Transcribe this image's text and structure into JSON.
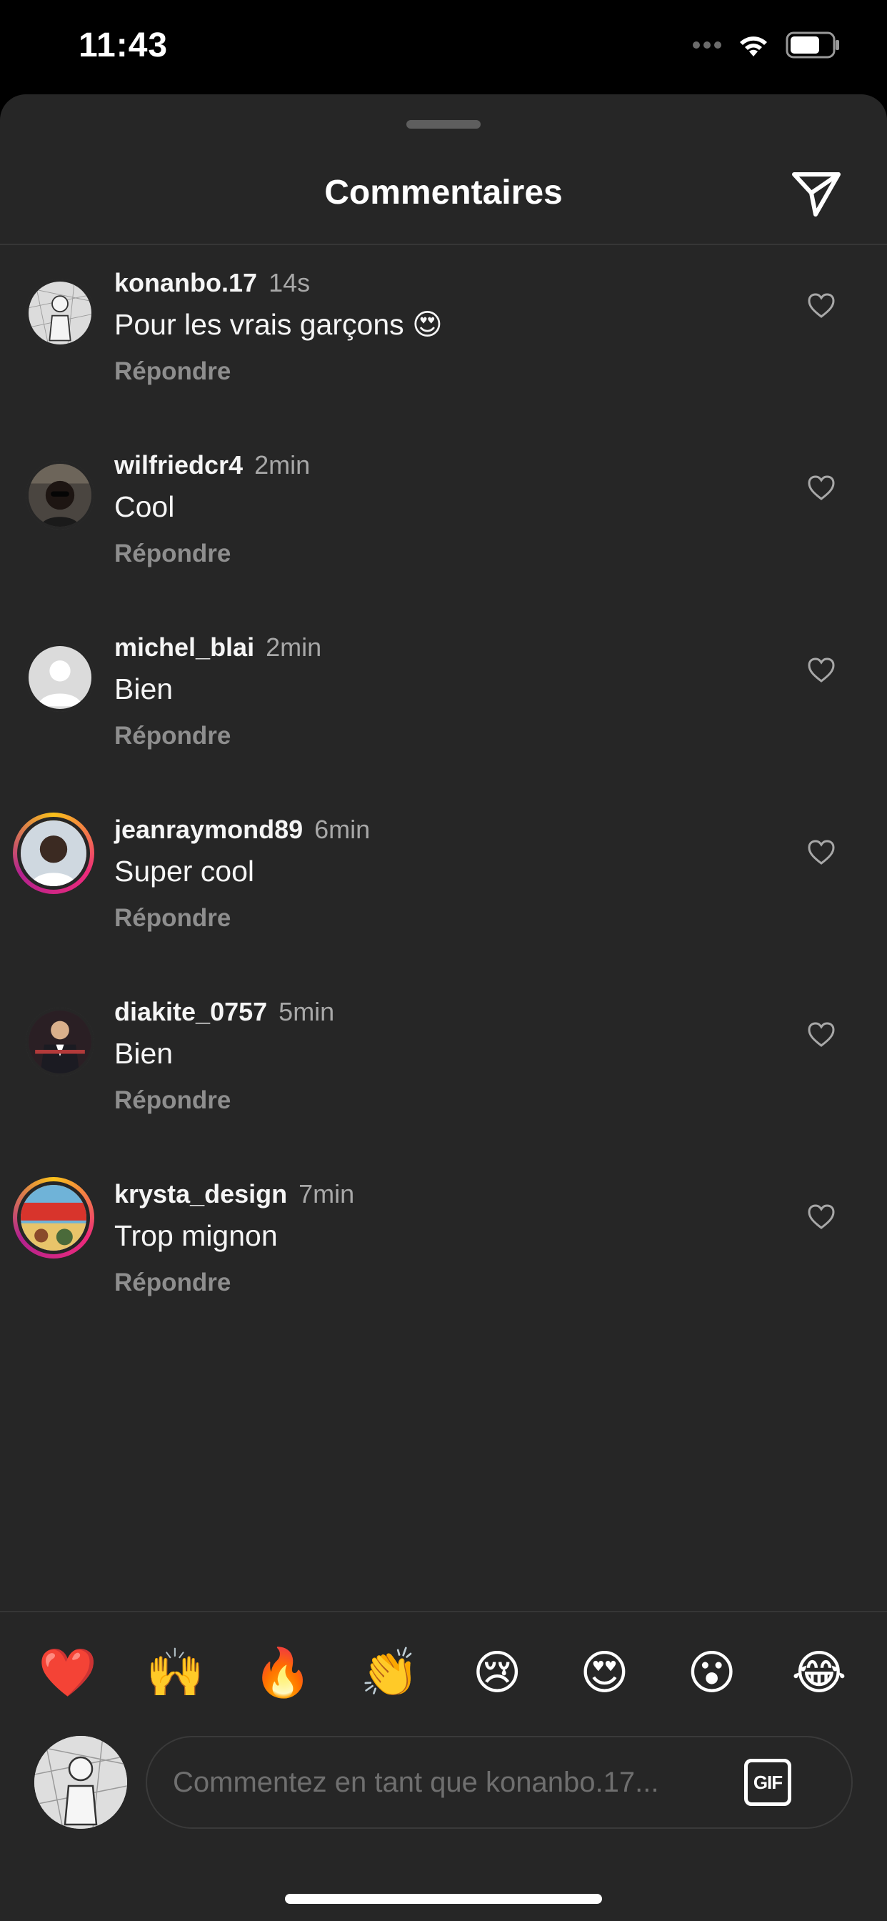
{
  "status_bar": {
    "time": "11:43"
  },
  "header": {
    "title": "Commentaires",
    "send_icon": "paper-plane-icon"
  },
  "comments": [
    {
      "username": "konanbo.17",
      "time": "14s",
      "text": "Pour les vrais garçons 😍",
      "reply_label": "Répondre",
      "avatar": "sketch-figure",
      "story_ring": false
    },
    {
      "username": "wilfriedcr4",
      "time": "2min",
      "text": "Cool",
      "reply_label": "Répondre",
      "avatar": "photo-person-dark",
      "story_ring": false
    },
    {
      "username": "michel_blai",
      "time": "2min",
      "text": "Bien",
      "reply_label": "Répondre",
      "avatar": "default-avatar",
      "story_ring": false
    },
    {
      "username": "jeanraymond89",
      "time": "6min",
      "text": "Super cool",
      "reply_label": "Répondre",
      "avatar": "photo-person",
      "story_ring": true
    },
    {
      "username": "diakite_0757",
      "time": "5min",
      "text": "Bien",
      "reply_label": "Répondre",
      "avatar": "photo-suit",
      "story_ring": false
    },
    {
      "username": "krysta_design",
      "time": "7min",
      "text": "Trop mignon",
      "reply_label": "Répondre",
      "avatar": "graphic-poster",
      "story_ring": true
    }
  ],
  "emoji_bar": [
    "❤️",
    "🙌",
    "🔥",
    "👏",
    "😢",
    "😍",
    "😮",
    "😂"
  ],
  "composer": {
    "placeholder": "Commentez en tant que konanbo.17...",
    "gif_label": "GIF"
  },
  "colors": {
    "sheet_background": "#262626",
    "story_ring_gradient": [
      "#f9c11a",
      "#ee2a7b",
      "#b3228e"
    ],
    "secondary_text": "#a8a8a8"
  }
}
